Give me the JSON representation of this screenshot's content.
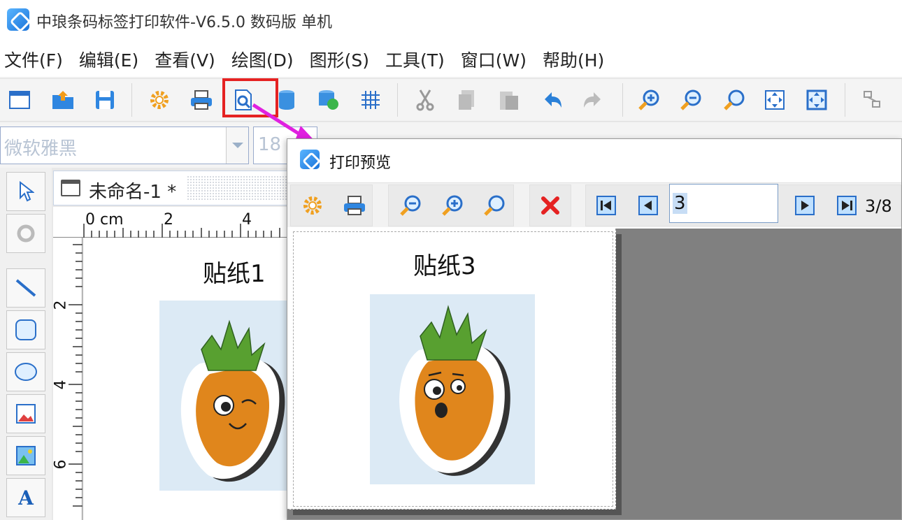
{
  "window": {
    "title": "中琅条码标签打印软件-V6.5.0 数码版 单机"
  },
  "menu": {
    "items": [
      "文件(F)",
      "编辑(E)",
      "查看(V)",
      "绘图(D)",
      "图形(S)",
      "工具(T)",
      "窗口(W)",
      "帮助(H)"
    ]
  },
  "font": {
    "family": "微软雅黑",
    "size": "18"
  },
  "document": {
    "tab_label": "未命名-1 *",
    "ruler_unit": "0 cm",
    "h_ticks": [
      "2",
      "4"
    ],
    "v_ticks": [
      "2",
      "4",
      "6"
    ],
    "sticker_title": "贴纸1"
  },
  "preview": {
    "title": "打印预览",
    "page_value": "3",
    "page_count": "3/8",
    "sticker_title": "贴纸3"
  },
  "colors": {
    "highlight": "#e52222",
    "arrow": "#e020e0",
    "accent": "#1a73d9"
  }
}
